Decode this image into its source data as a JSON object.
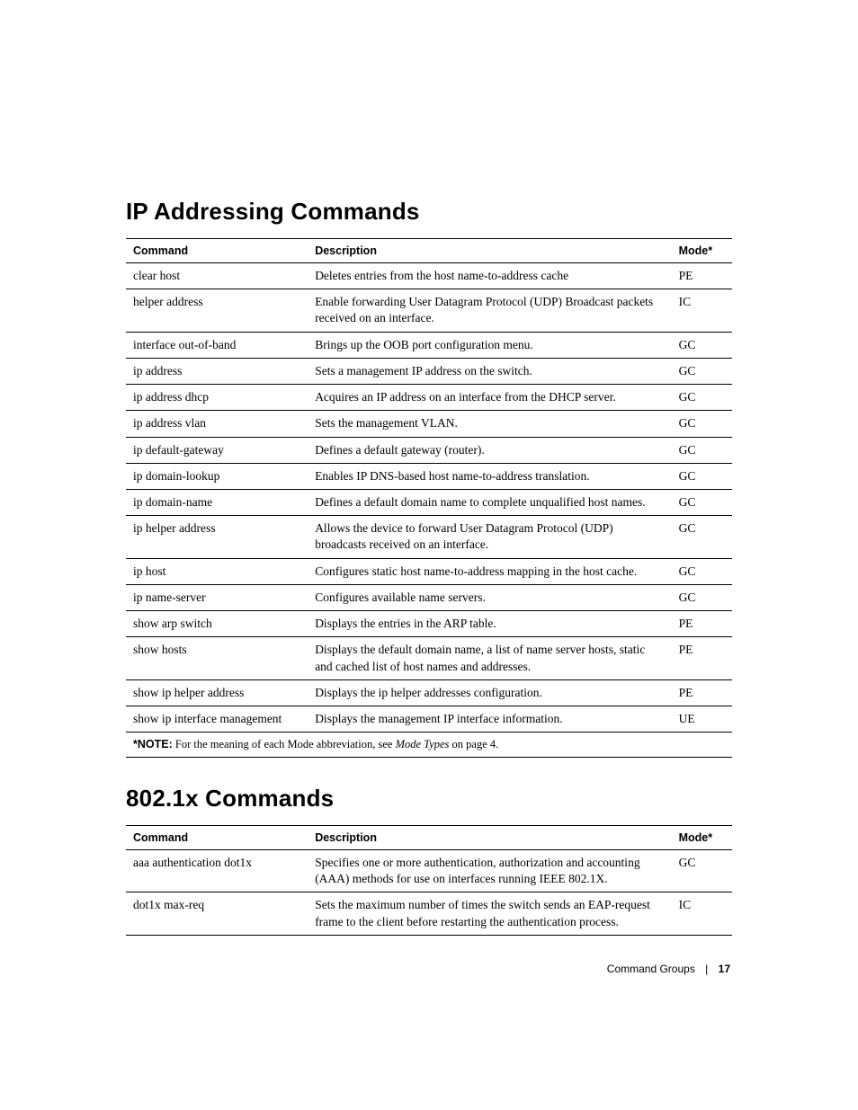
{
  "sections": [
    {
      "heading": "IP Addressing Commands",
      "columns": {
        "command": "Command",
        "description": "Description",
        "mode": "Mode*"
      },
      "rows": [
        {
          "command": "clear host",
          "description": "Deletes entries from the host name-to-address cache",
          "mode": "PE"
        },
        {
          "command": "helper address",
          "description": "Enable forwarding User Datagram Protocol (UDP) Broadcast packets received on an interface.",
          "mode": "IC"
        },
        {
          "command": "interface out-of-band",
          "description": "Brings up the OOB port configuration menu.",
          "mode": "GC"
        },
        {
          "command": "ip address",
          "description": "Sets a management IP address on the switch.",
          "mode": "GC"
        },
        {
          "command": "ip address dhcp",
          "description": "Acquires an IP address on an interface from the DHCP server.",
          "mode": "GC"
        },
        {
          "command": "ip address vlan",
          "description": "Sets the management VLAN.",
          "mode": "GC"
        },
        {
          "command": "ip default-gateway",
          "description": "Defines a default gateway (router).",
          "mode": "GC"
        },
        {
          "command": "ip domain-lookup",
          "description": "Enables IP DNS-based host name-to-address translation.",
          "mode": "GC"
        },
        {
          "command": "ip domain-name",
          "description": "Defines a default domain name to complete unqualified host names.",
          "mode": "GC"
        },
        {
          "command": "ip helper address",
          "description": "Allows the device to forward User Datagram Protocol (UDP) broadcasts received on an interface.",
          "mode": "GC"
        },
        {
          "command": "ip host",
          "description": "Configures static host name-to-address mapping in the host cache.",
          "mode": "GC"
        },
        {
          "command": "ip name-server",
          "description": "Configures available name servers.",
          "mode": "GC"
        },
        {
          "command": "show arp switch",
          "description": "Displays the entries in the ARP table.",
          "mode": "PE"
        },
        {
          "command": "show hosts",
          "description": "Displays the default domain name, a list of name server hosts, static and cached list of host names and addresses.",
          "mode": "PE"
        },
        {
          "command": "show ip helper address",
          "description": "Displays the ip helper addresses configuration.",
          "mode": "PE"
        },
        {
          "command": "show ip interface management",
          "description": "Displays the management IP interface information.",
          "mode": "UE"
        }
      ],
      "note": {
        "prefix": "*NOTE:",
        "mid": " For the meaning of each Mode abbreviation, see ",
        "italic": "Mode Types",
        "suffix": " on page 4."
      }
    },
    {
      "heading": "802.1x Commands",
      "columns": {
        "command": "Command",
        "description": "Description",
        "mode": "Mode*"
      },
      "rows": [
        {
          "command": "aaa authentication dot1x",
          "description": "Specifies one or more authentication, authorization and accounting (AAA) methods for use on interfaces running IEEE 802.1X.",
          "mode": "GC"
        },
        {
          "command": "dot1x max-req",
          "description": "Sets the maximum number of times the switch sends an EAP-request frame to the client before restarting the authentication process.",
          "mode": "IC"
        }
      ]
    }
  ],
  "footer": {
    "label": "Command Groups",
    "page": "17"
  }
}
